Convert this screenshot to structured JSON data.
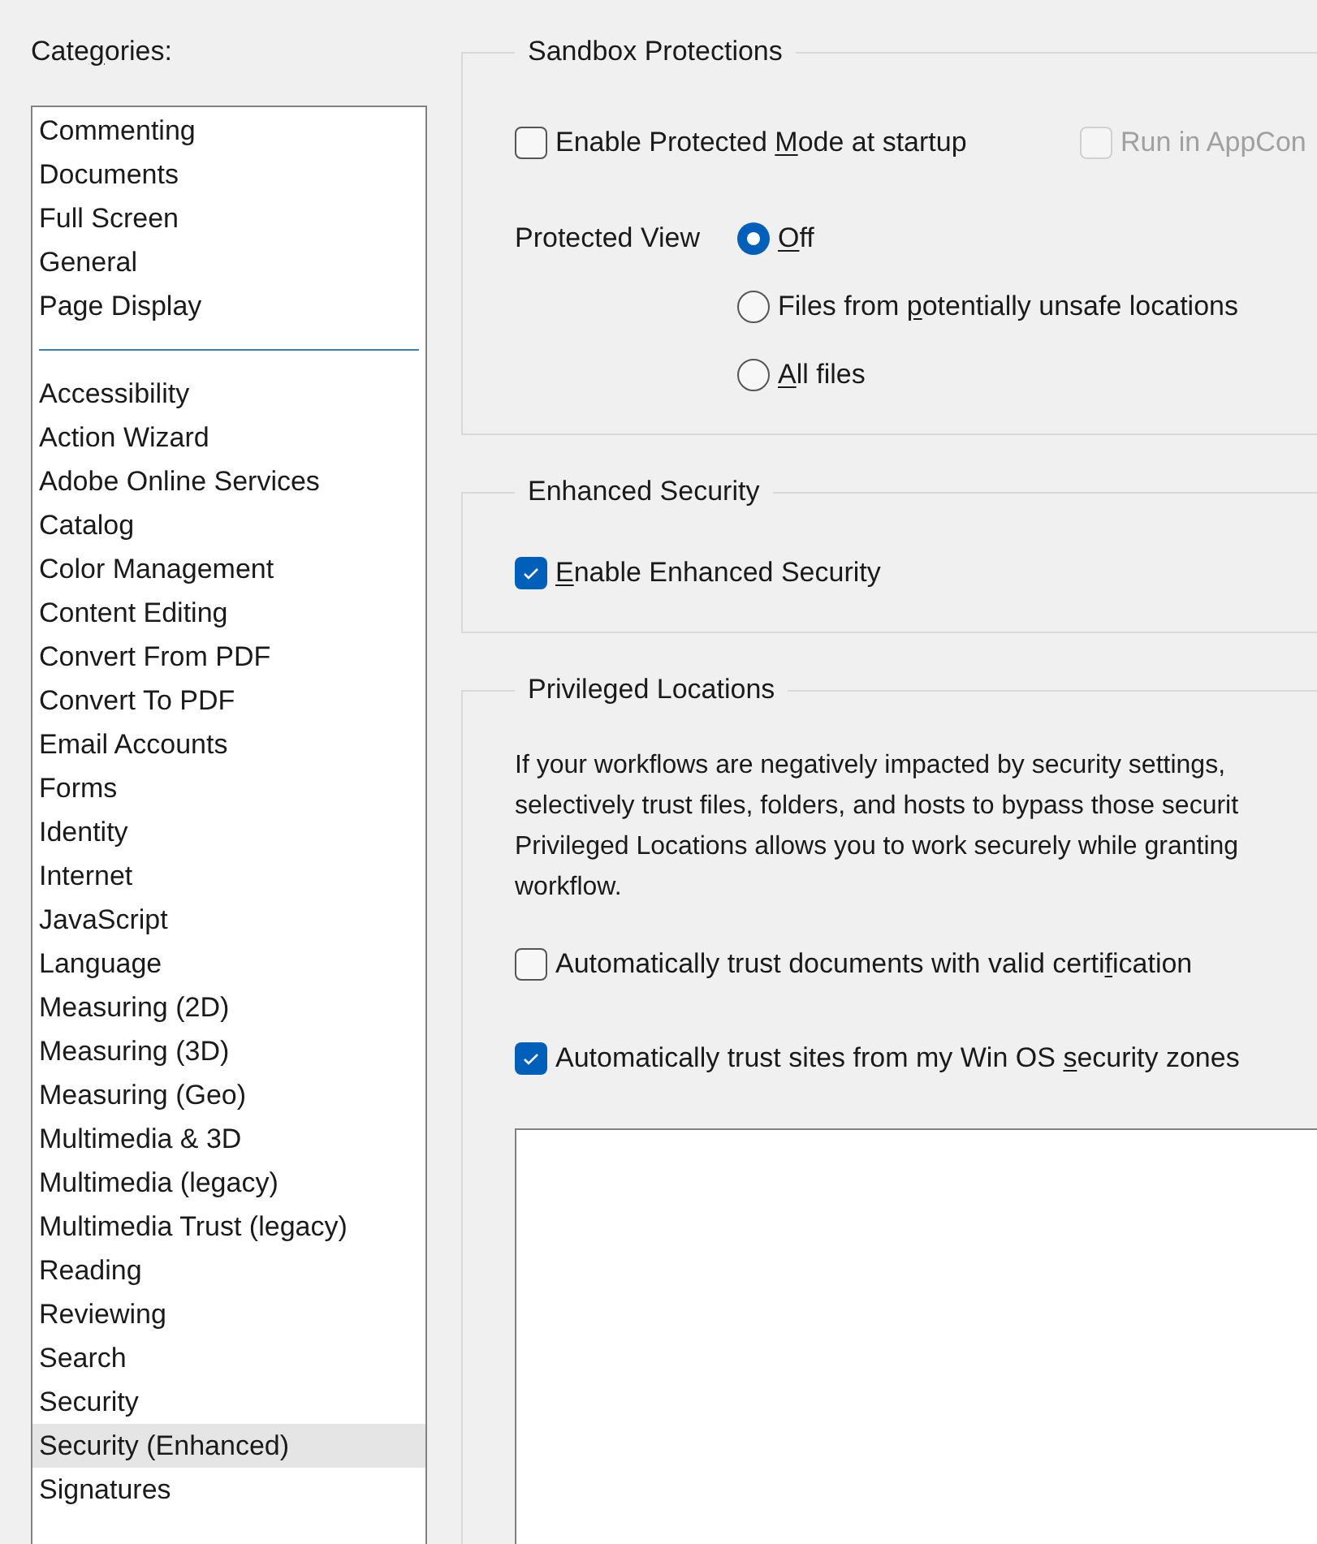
{
  "categories": {
    "label_parts": {
      "before": "Cate",
      "key": "g",
      "after": "ories:"
    },
    "pinned_items": [
      {
        "label": "Commenting",
        "selected": false
      },
      {
        "label": "Documents",
        "selected": false
      },
      {
        "label": "Full Screen",
        "selected": false
      },
      {
        "label": "General",
        "selected": false
      },
      {
        "label": "Page Display",
        "selected": false
      }
    ],
    "items": [
      {
        "label": "Accessibility",
        "selected": false
      },
      {
        "label": "Action Wizard",
        "selected": false
      },
      {
        "label": "Adobe Online Services",
        "selected": false
      },
      {
        "label": "Catalog",
        "selected": false
      },
      {
        "label": "Color Management",
        "selected": false
      },
      {
        "label": "Content Editing",
        "selected": false
      },
      {
        "label": "Convert From PDF",
        "selected": false
      },
      {
        "label": "Convert To PDF",
        "selected": false
      },
      {
        "label": "Email Accounts",
        "selected": false
      },
      {
        "label": "Forms",
        "selected": false
      },
      {
        "label": "Identity",
        "selected": false
      },
      {
        "label": "Internet",
        "selected": false
      },
      {
        "label": "JavaScript",
        "selected": false
      },
      {
        "label": "Language",
        "selected": false
      },
      {
        "label": "Measuring (2D)",
        "selected": false
      },
      {
        "label": "Measuring (3D)",
        "selected": false
      },
      {
        "label": "Measuring (Geo)",
        "selected": false
      },
      {
        "label": "Multimedia & 3D",
        "selected": false
      },
      {
        "label": "Multimedia (legacy)",
        "selected": false
      },
      {
        "label": "Multimedia Trust (legacy)",
        "selected": false
      },
      {
        "label": "Reading",
        "selected": false
      },
      {
        "label": "Reviewing",
        "selected": false
      },
      {
        "label": "Search",
        "selected": false
      },
      {
        "label": "Security",
        "selected": false
      },
      {
        "label": "Security (Enhanced)",
        "selected": true
      },
      {
        "label": "Signatures",
        "selected": false
      }
    ]
  },
  "sandbox_protections": {
    "title": "Sandbox Protections",
    "checkboxes": [
      {
        "label_parts": {
          "before": "Enable Protected ",
          "key": "M",
          "after": "ode at startup"
        },
        "checked": false,
        "disabled": false
      },
      {
        "label_parts": {
          "before": "Run in AppCon"
        },
        "checked": false,
        "disabled": true
      }
    ],
    "protected_view": {
      "label": "Protected View",
      "options": [
        {
          "label_parts": {
            "key": "O",
            "after": "ff"
          },
          "selected": true
        },
        {
          "label_parts": {
            "before": "Files from ",
            "key": "p",
            "after": "otentially unsafe locations"
          },
          "selected": false
        },
        {
          "label_parts": {
            "key": "A",
            "after": "ll files"
          },
          "selected": false
        }
      ]
    }
  },
  "enhanced_security": {
    "title": "Enhanced Security",
    "checkbox": {
      "label_parts": {
        "key": "E",
        "after": "nable Enhanced Security"
      },
      "checked": true,
      "disabled": false
    }
  },
  "privileged_locations": {
    "title": "Privileged Locations",
    "description_lines": [
      "If your workflows are negatively impacted by security settings,",
      "selectively trust files, folders, and hosts to bypass those securit",
      "Privileged Locations allows you to work securely while granting",
      "workflow."
    ],
    "checkboxes": [
      {
        "label_parts": {
          "before": "Automatically trust documents with valid certi",
          "key": "f",
          "after": "ication"
        },
        "checked": false,
        "disabled": false
      },
      {
        "label_parts": {
          "before": "Automatically trust sites from my Win OS ",
          "key": "s",
          "after": "ecurity zones"
        },
        "checked": true,
        "disabled": false
      }
    ]
  }
}
